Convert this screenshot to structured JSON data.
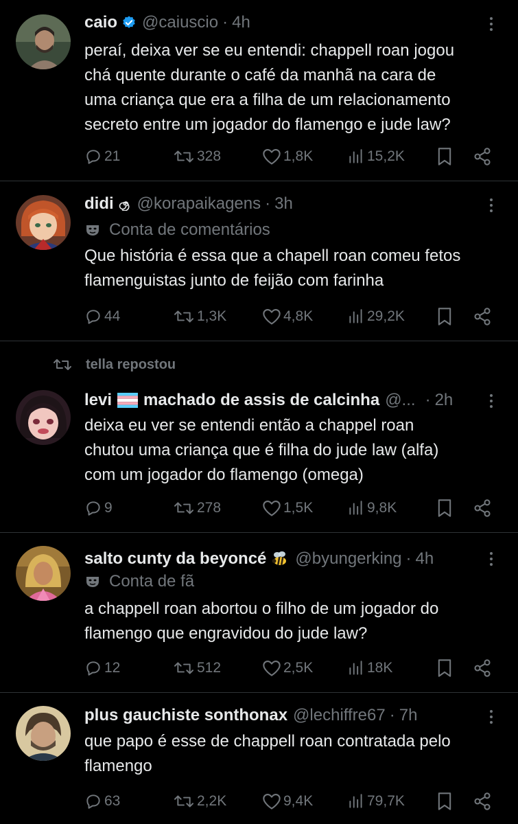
{
  "tweets": [
    {
      "name": "caio",
      "handle": "@caiuscio",
      "time": "4h",
      "verified": true,
      "lines": [
        "peraí, deixa ver se eu entendi: chappell roan jogou",
        "chá quente durante o café da manhã na cara de",
        "uma criança que era a filha de um relacionamento",
        "secreto entre um jogador do flamengo e jude law?"
      ],
      "replies": "21",
      "reposts": "328",
      "likes": "1,8K",
      "views": "15,2K"
    },
    {
      "name": "didi",
      "handle": "@korapaikagens",
      "time": "3h",
      "label": "Conta de comentários",
      "lines": [
        "Que história é essa que a chapell roan comeu fetos",
        "flamenguistas junto de feijão com farinha"
      ],
      "replies": "44",
      "reposts": "1,3K",
      "likes": "4,8K",
      "views": "29,2K"
    },
    {
      "repost_by": "tella repostou",
      "name": "levi",
      "name_rest": "machado de assis de calcinha",
      "handle": "@...",
      "time": "2h",
      "lines": [
        "deixa eu ver se entendi então a chappel roan",
        "chutou uma criança que é filha do jude law (alfa)",
        "com um jogador do flamengo (omega)"
      ],
      "replies": "9",
      "reposts": "278",
      "likes": "1,5K",
      "views": "9,8K"
    },
    {
      "name": "salto cunty da beyoncé",
      "handle": "@byungerking",
      "time": "4h",
      "label": "Conta de fã",
      "lines": [
        "a chappell roan abortou o filho de um jogador do",
        "flamengo que engravidou do jude law?"
      ],
      "replies": "12",
      "reposts": "512",
      "likes": "2,5K",
      "views": "18K"
    },
    {
      "name": "plus gauchiste sonthonax",
      "handle": "@lechiffre67",
      "time": "7h",
      "lines": [
        "que papo é esse de chappell roan contratada pelo",
        "flamengo"
      ],
      "replies": "63",
      "reposts": "2,2K",
      "likes": "9,4K",
      "views": "79,7K"
    }
  ],
  "separator": "·",
  "colors": {
    "background": "#000000",
    "text": "#e7e9ea",
    "muted": "#71767b",
    "divider": "#2f3336",
    "verified": "#1d9bf0"
  }
}
